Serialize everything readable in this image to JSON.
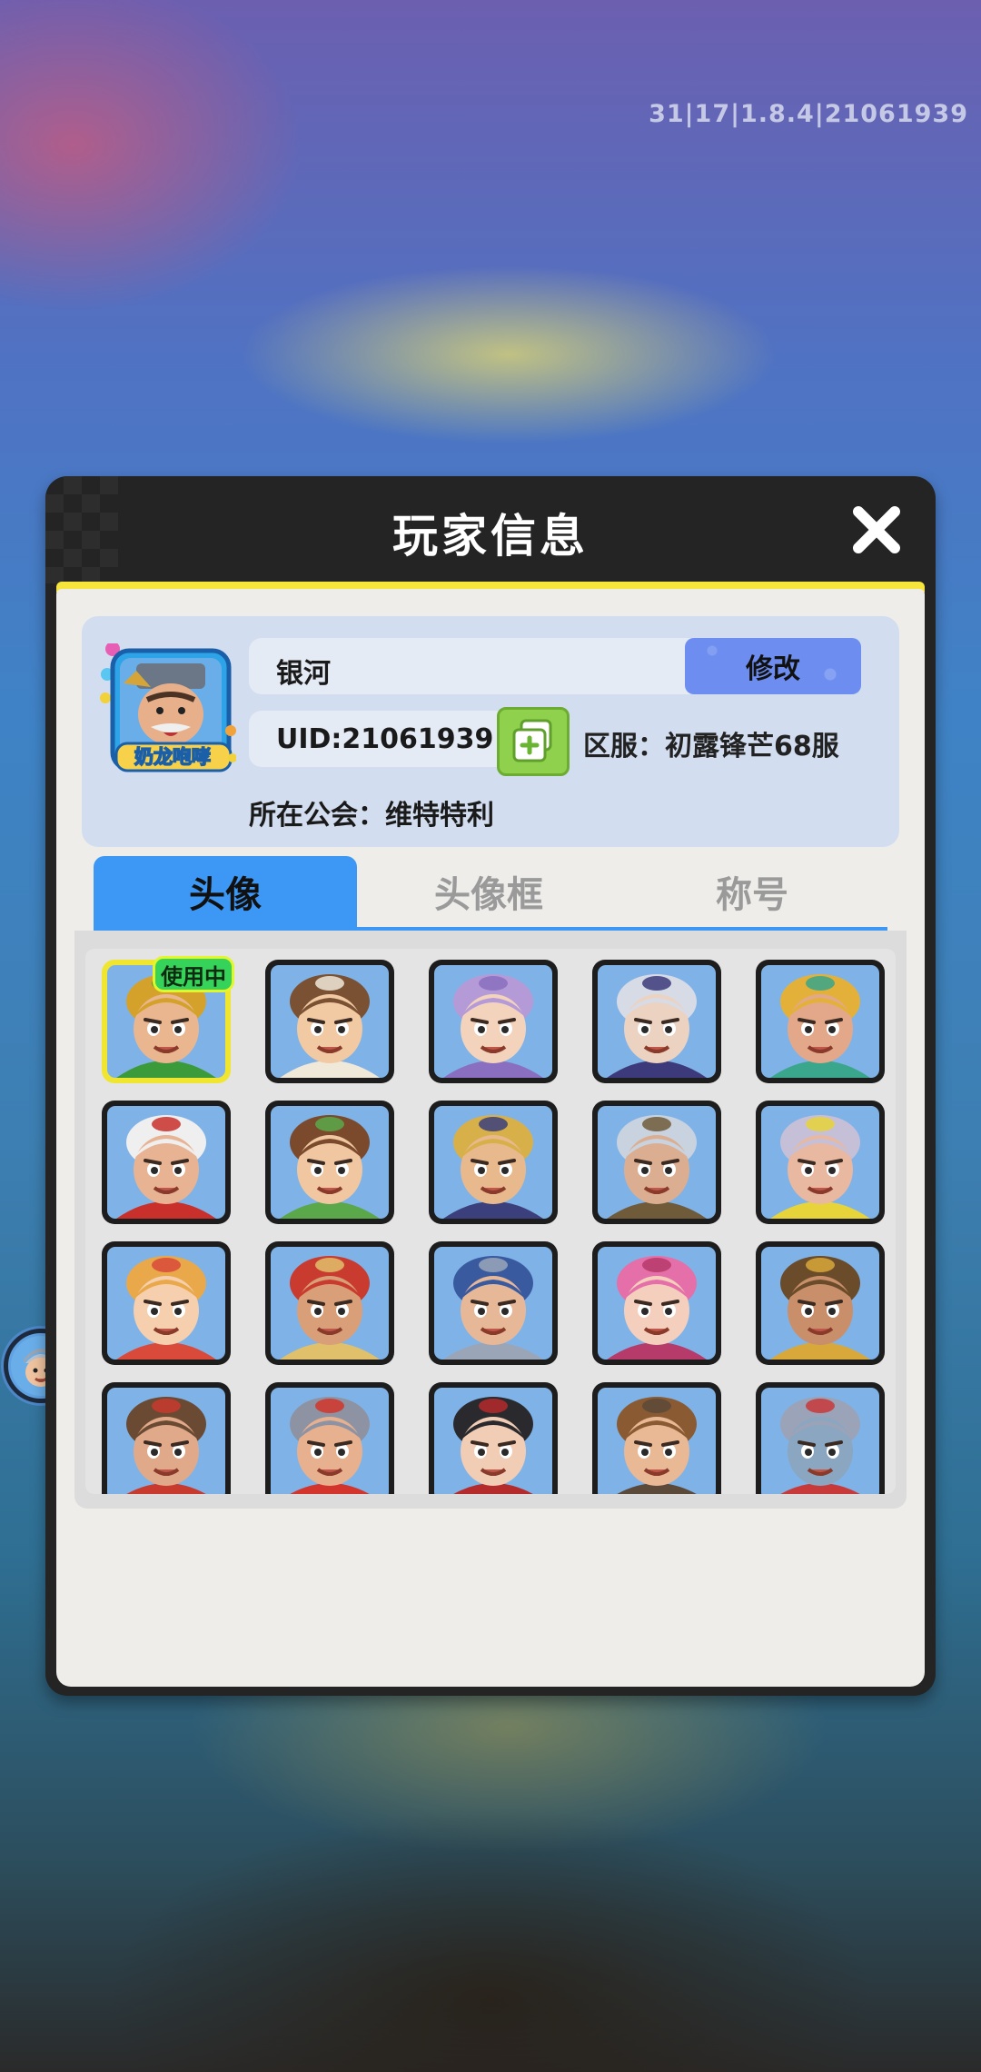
{
  "version_text": "31|17|1.8.4|21061939",
  "dialog": {
    "title": "玩家信息"
  },
  "profile": {
    "name": "银河",
    "edit_label": "修改",
    "uid": "UID:21061939",
    "server": "区服：初露锋芒68服",
    "guild": "所在公会：维特特利",
    "frame_banner": "奶龙咆哮"
  },
  "tabs": [
    {
      "label": "头像",
      "active": true
    },
    {
      "label": "头像框",
      "active": false
    },
    {
      "label": "称号",
      "active": false
    }
  ],
  "avatar_grid": {
    "in_use_label": "使用中",
    "items": [
      {
        "hair": "#d4a22b",
        "skin": "#e9b68f",
        "accent": "#3b9b3a",
        "selected": true
      },
      {
        "hair": "#7a5233",
        "skin": "#f1c9a3",
        "accent": "#f0e8d8"
      },
      {
        "hair": "#b59ad8",
        "skin": "#f4d3bd",
        "accent": "#8a6fc0"
      },
      {
        "hair": "#d7dbe6",
        "skin": "#ecd2c0",
        "accent": "#3c3a7a"
      },
      {
        "hair": "#e3b13a",
        "skin": "#e3a889",
        "accent": "#3aa68b"
      },
      {
        "hair": "#efefef",
        "skin": "#e8b392",
        "accent": "#c9302c"
      },
      {
        "hair": "#7b4a2c",
        "skin": "#f0c7a1",
        "accent": "#5aa84a"
      },
      {
        "hair": "#d8b04a",
        "skin": "#e8b98d",
        "accent": "#3b3f7b"
      },
      {
        "hair": "#c9d3e0",
        "skin": "#dcae91",
        "accent": "#6f5a3a"
      },
      {
        "hair": "#c6bfd8",
        "skin": "#e8b8a0",
        "accent": "#e6d43a"
      },
      {
        "hair": "#e9a849",
        "skin": "#f5cfae",
        "accent": "#d94a3a"
      },
      {
        "hair": "#c83b2e",
        "skin": "#d99f78",
        "accent": "#e0c06a"
      },
      {
        "hair": "#3a5aa0",
        "skin": "#e7b898",
        "accent": "#9aa6b8"
      },
      {
        "hair": "#e56fa8",
        "skin": "#f4cfbd",
        "accent": "#b63a6a"
      },
      {
        "hair": "#6a4b2a",
        "skin": "#c98e6a",
        "accent": "#d8a83a"
      },
      {
        "hair": "#6a4a33",
        "skin": "#e0a989",
        "accent": "#c8392e"
      },
      {
        "hair": "#8d93a3",
        "skin": "#e7b08e",
        "accent": "#d3352c"
      },
      {
        "hair": "#2a2a2e",
        "skin": "#f1cdb5",
        "accent": "#b52a2a"
      },
      {
        "hair": "#8a5a33",
        "skin": "#e9b894",
        "accent": "#5b4a3a"
      },
      {
        "hair": "#9aa3b8",
        "skin": "#8aa6c0",
        "accent": "#c83a3a"
      }
    ]
  },
  "colors": {
    "dialog_bg": "#242424",
    "panel_bg": "#eeedea",
    "accent_blue": "#3d98f5",
    "highlight_yellow": "#f7e53c",
    "copy_green": "#8fd14d"
  },
  "icons": {
    "close": "close-icon",
    "copy": "copy-icon",
    "side_avatar": "player-avatar-icon"
  }
}
